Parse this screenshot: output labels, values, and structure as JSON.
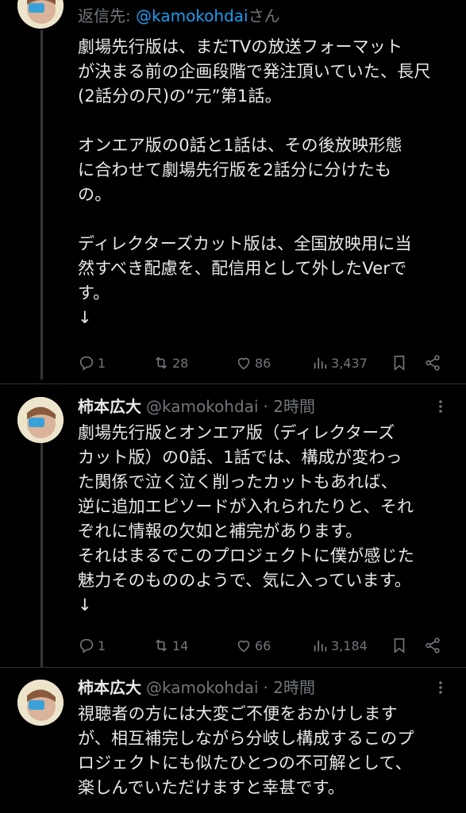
{
  "tweets": [
    {
      "reply_prefix": "返信先: ",
      "reply_handle": "@kamokohdai",
      "reply_suffix": "さん",
      "text": "劇場先行版は、まだTVの放送フォーマット\nが決まる前の企画段階で発注頂いていた、長尺\n(2話分の尺)の“元”第1話。\n\nオンエア版の0話と1話は、その後放映形態\nに合わせて劇場先行版を2話分に分けたも\nの。\n\nディレクターズカット版は、全国放映用に当\n然すべき配慮を、配信用として外したVerで\nす。\n↓",
      "replies": "1",
      "retweets": "28",
      "likes": "86",
      "views": "3,437"
    },
    {
      "name": "柿本広大",
      "handle": "@kamokohdai",
      "time": "· 2時間",
      "text": "劇場先行版とオンエア版（ディレクターズ\nカット版）の0話、1話では、構成が変わっ\nた関係で泣く泣く削ったカットもあれば、\n逆に追加エピソードが入れられたりと、それ\nぞれに情報の欠如と補完があります。\nそれはまるでこのプロジェクトに僕が感じた\n魅力そのもののようで、気に入っています。\n↓",
      "replies": "1",
      "retweets": "14",
      "likes": "66",
      "views": "3,184"
    },
    {
      "name": "柿本広大",
      "handle": "@kamokohdai",
      "time": "· 2時間",
      "text": "視聴者の方には大変ご不便をおかけします\nが、相互補完しながら分岐し構成するこのプ\nロジェクトにも似たひとつの不可解として、\n楽しんでいただけますと幸甚です。"
    }
  ],
  "colors": {
    "background": "#000000",
    "text": "#e7e9ea",
    "muted": "#71767b",
    "link": "#1d9bf0"
  },
  "icons": [
    "reply-icon",
    "retweet-icon",
    "like-icon",
    "views-icon",
    "bookmark-icon",
    "share-icon",
    "more-icon"
  ]
}
